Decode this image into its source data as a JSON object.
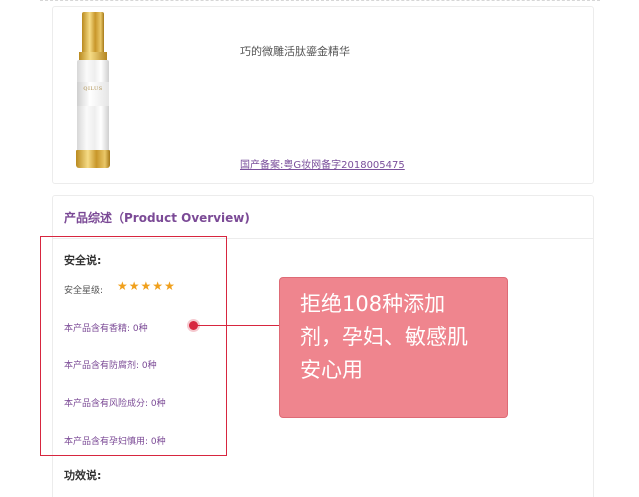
{
  "product": {
    "name": "巧的微雕活肽鎏金精华",
    "registration": "国产备案:粤G妆网备字2018005475",
    "bottle_brand": "QILUS"
  },
  "overview": {
    "title": "产品综述（Product Overview)",
    "safety": {
      "title": "安全说:",
      "star_label": "安全星级:",
      "star_count": 5,
      "stats": [
        "本产品含有香精: 0种",
        "本产品含有防腐剂: 0种",
        "本产品含有风险成分: 0种",
        "本产品含有孕妇慎用: 0种"
      ]
    },
    "effect_title": "功效说:"
  },
  "callout": {
    "text": "拒绝108种添加剂，孕妇、敏感肌安心用"
  },
  "colors": {
    "accent_purple": "#7b4a96",
    "highlight_red": "#d7263f",
    "callout_bg": "#ef858e",
    "star": "#f0a01c"
  }
}
